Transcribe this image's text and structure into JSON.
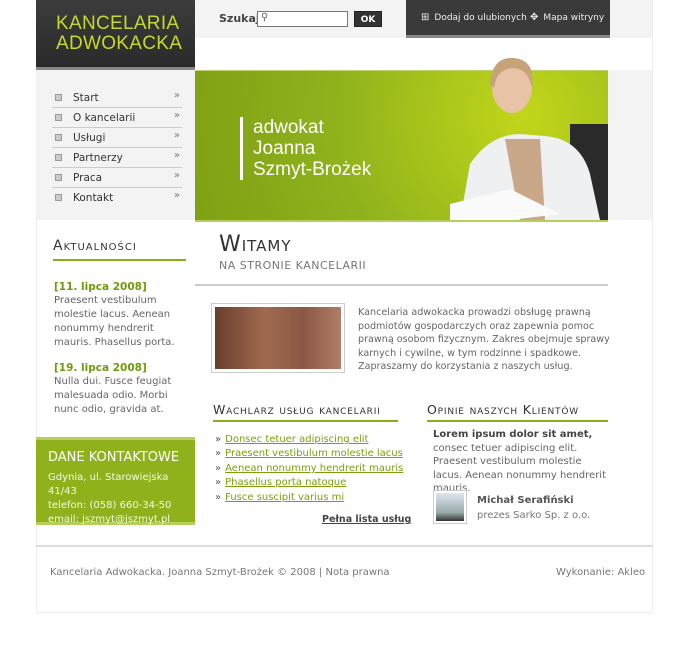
{
  "logo": {
    "line1": "KANCELARIA",
    "line2": "ADWOKACKA"
  },
  "search": {
    "label": "Szukaj",
    "placeholder": "",
    "button": "OK"
  },
  "toplinks": [
    {
      "icon": "plus-square-icon",
      "label": "Dodaj do ulubionych"
    },
    {
      "icon": "sitemap-icon",
      "label": "Mapa witryny"
    }
  ],
  "menu": [
    "Start",
    "O kancelarii",
    "Usługi",
    "Partnerzy",
    "Praca",
    "Kontakt"
  ],
  "banner": {
    "line1": "adwokat",
    "line2": "Joanna",
    "line3": "Szmyt-Brożek"
  },
  "news": {
    "title": "Aktualności",
    "items": [
      {
        "date": "[11. lipca 2008]",
        "text": "Praesent vestibulum molestie lacus. Aenean nonummy hendrerit mauris. Phasellus porta."
      },
      {
        "date": "[19. lipca 2008]",
        "text": "Nulla dui. Fusce feugiat malesuada odio. Morbi nunc odio, gravida at."
      }
    ]
  },
  "contact": {
    "title": "DANE KONTAKTOWE",
    "address": "Gdynia, ul. Starowiejska 41/43",
    "phone": "telefon: (058) 660-34-50",
    "email": "email: jszmyt@jszmyt.pl"
  },
  "welcome": {
    "title": "Witamy",
    "subtitle": "NA STRONIE KANCELARII",
    "text": "Kancelaria adwokacka prowadzi obsługę prawną podmiotów gospodarczych oraz zapewnia pomoc prawną osobom fizycznym. Zakres obejmuje sprawy karnych i cywilne, w tym rodzinne i spadkowe.",
    "text2": "Zapraszamy do korzystania z naszych usług."
  },
  "services": {
    "title": "Wachlarz usług kancelarii",
    "items": [
      "Donsec tetuer adipiscing elit",
      "Praesent vestibulum molestie lacus",
      "Aenean nonummy hendrerit mauris",
      "Phasellus porta natoque",
      "Fusce suscipit varius mi"
    ],
    "more": "Pełna lista usług"
  },
  "opinions": {
    "title": "Opinie naszych Klientów",
    "lead": "Lorem ipsum dolor sit amet,",
    "text": "consec tetuer adipiscing elit. Praesent vestibulum molestie lacus. Aenean nonummy hendrerit mauris.",
    "name": "Michał Serafiński",
    "role": "prezes Sarko Sp. z o.o."
  },
  "footer": {
    "copy": "Kancelaria Adwokacka. Joanna Szmyt-Brożek © 2008",
    "sep": "|",
    "legal": "Nota prawna",
    "credit": "Wykonanie: Akleo"
  }
}
